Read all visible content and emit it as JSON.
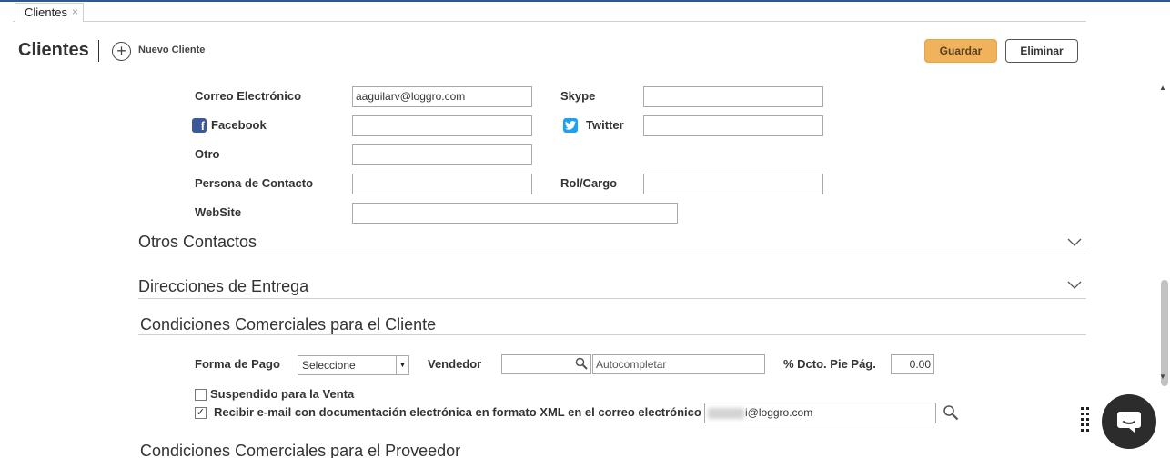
{
  "tab": {
    "label": "Clientes",
    "close": "×"
  },
  "header": {
    "title": "Clientes",
    "new_label": "Nuevo Cliente",
    "save_label": "Guardar",
    "delete_label": "Eliminar"
  },
  "contact": {
    "email_label": "Correo Electrónico",
    "email_value": "aaguilarv@loggro.com",
    "skype_label": "Skype",
    "skype_value": "",
    "facebook_label": "Facebook",
    "facebook_value": "",
    "twitter_label": "Twitter",
    "twitter_value": "",
    "otro_label": "Otro",
    "otro_value": "",
    "persona_label": "Persona de Contacto",
    "persona_value": "",
    "rol_label": "Rol/Cargo",
    "rol_value": "",
    "website_label": "WebSite",
    "website_value": ""
  },
  "sections": {
    "otros_contactos": "Otros Contactos",
    "direcciones": "Direcciones de Entrega",
    "condiciones_cliente": "Condiciones Comerciales para el Cliente",
    "condiciones_proveedor": "Condiciones Comerciales para el Proveedor"
  },
  "condiciones": {
    "forma_pago_label": "Forma de Pago",
    "forma_pago_value": "Seleccione",
    "vendedor_label": "Vendedor",
    "vendedor_code": "",
    "vendedor_placeholder": "Autocompletar",
    "descuento_label": "% Dcto. Pie Pág.",
    "descuento_value": "0.00",
    "suspendido_label": "Suspendido para la Venta",
    "suspendido_checked": false,
    "recibir_label": "Recibir e-mail con documentación electrónica en formato XML en el correo electrónico",
    "recibir_checked": true,
    "recibir_email_visible": "i@loggro.com"
  },
  "icons": {
    "add": "plus-circle-icon",
    "facebook": "facebook-icon",
    "twitter": "twitter-icon",
    "search": "search-icon",
    "chevron": "chevron-down-icon",
    "chat": "chat-icon",
    "menu": "drag-handle-icon"
  },
  "colors": {
    "accent_save": "#f0b35b",
    "facebook": "#3b5998",
    "twitter": "#1da1f2",
    "top_border": "#2a5b8c"
  }
}
